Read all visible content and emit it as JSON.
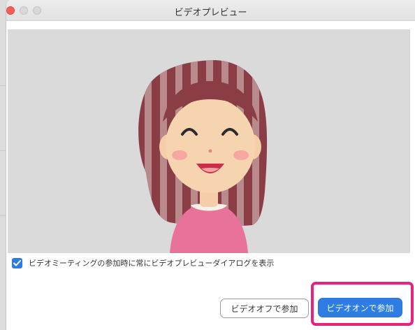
{
  "window": {
    "title": "ビデオプレビュー"
  },
  "preview": {
    "checkbox_checked": true,
    "checkbox_label": "ビデオミーティングの参加時に常にビデオプレビューダイアログを表示"
  },
  "buttons": {
    "video_off_label": "ビデオオフで参加",
    "video_on_label": "ビデオオンで参加"
  },
  "colors": {
    "accent": "#2d7de4",
    "highlight": "#e8237d",
    "close": "#fe5f57"
  }
}
